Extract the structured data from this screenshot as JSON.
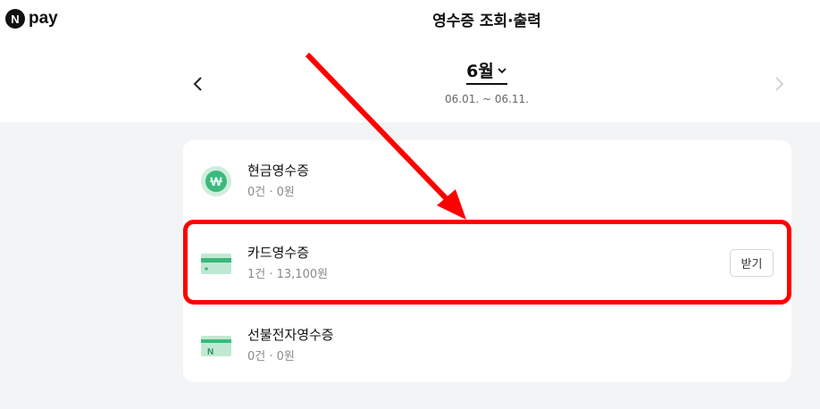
{
  "brand": {
    "badge": "N",
    "name": "pay"
  },
  "header": {
    "title": "영수증 조회·출력"
  },
  "period": {
    "month": "6월",
    "range": "06.01. ~ 06.11."
  },
  "receipts": [
    {
      "icon": "won-coin-icon",
      "title": "현금영수증",
      "summary": "0건 · 0원"
    },
    {
      "icon": "card-icon",
      "title": "카드영수증",
      "summary": "1건 · 13,100원",
      "action": "받기"
    },
    {
      "icon": "prepaid-card-icon",
      "title": "선불전자영수증",
      "summary": "0건 · 0원"
    }
  ],
  "colors": {
    "accent_green": "#36b37e",
    "highlight_red": "#ff0000"
  }
}
